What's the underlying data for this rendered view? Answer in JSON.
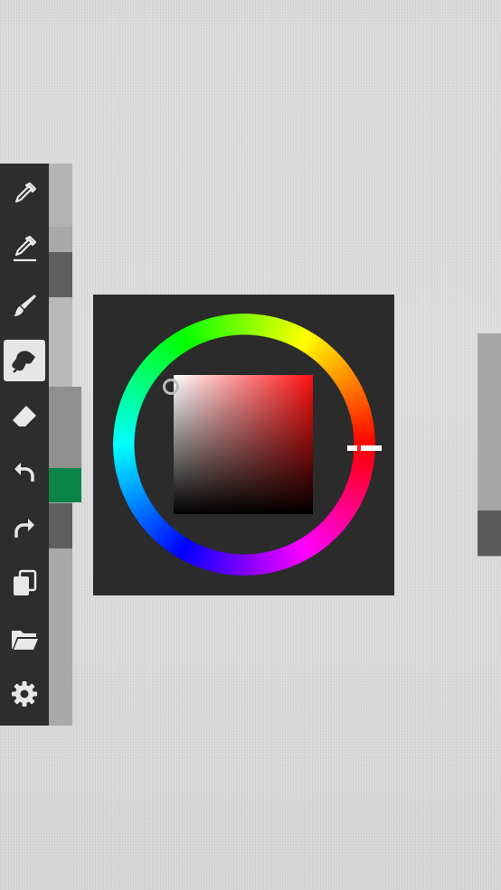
{
  "toolbar": {
    "tools": [
      {
        "icon": "eyedropper-icon",
        "active": false
      },
      {
        "icon": "eyedropper-line-icon",
        "active": false
      },
      {
        "icon": "brush-icon",
        "active": false
      },
      {
        "icon": "smudge-brush-icon",
        "active": true
      },
      {
        "icon": "eraser-icon",
        "active": false
      },
      {
        "icon": "undo-icon",
        "active": false
      },
      {
        "icon": "redo-icon",
        "active": false
      },
      {
        "icon": "layers-icon",
        "active": false
      },
      {
        "icon": "folder-icon",
        "active": false
      },
      {
        "icon": "gear-icon",
        "active": false
      }
    ]
  },
  "colors": {
    "toolbar_bg": "#2d2d2d",
    "panel_bg": "#2b2b2b",
    "current_color": "#0a8448",
    "selected_hue": "#ff0000",
    "rail_bg": "#a9a9a9",
    "rail_thumb": "#5b5b5b"
  },
  "color_picker": {
    "hue_degrees": 0,
    "saturation": 0.0,
    "value": 1.0
  }
}
